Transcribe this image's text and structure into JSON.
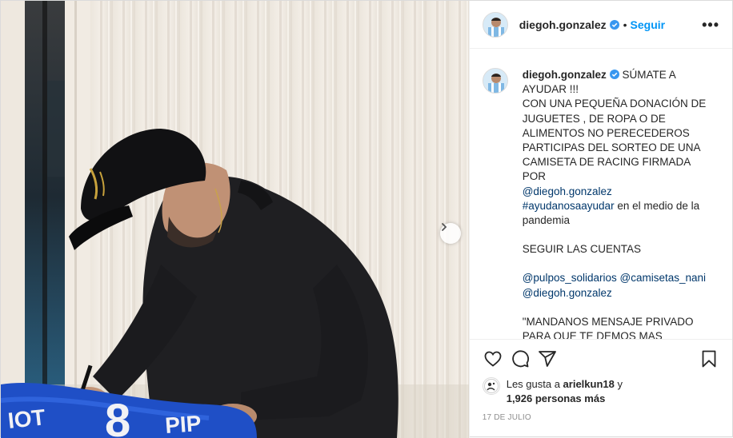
{
  "post": {
    "username": "diegoh.gonzalez",
    "verified": true,
    "follow_label": "Seguir",
    "more_label": "•••",
    "caption": {
      "lines": [
        {
          "type": "text",
          "text": "SÚMATE A AYUDAR !!!"
        },
        {
          "type": "text",
          "text": "CON UNA PEQUEÑA DONACIÓN DE JUGUETES , DE ROPA O DE ALIMENTOS NO PERECEDEROS PARTICIPAS DEL SORTEO DE UNA CAMISETA DE RACING FIRMADA POR"
        },
        {
          "type": "link",
          "text": "@diegoh.gonzalez"
        },
        {
          "type": "mixed",
          "link": "#ayudanosaayudar",
          "text": " en el medio de la pandemia"
        },
        {
          "type": "text",
          "text": "SEGUIR LAS CUENTAS"
        },
        {
          "type": "links",
          "items": [
            "@pulpos_solidarios",
            "@camisetas_nani",
            "@diegoh.gonzalez"
          ]
        },
        {
          "type": "text",
          "text": "\"MANDANOS MENSAJE PRIVADO PARA QUE TE DEMOS MAS DIRECCIONES DONDE PODER DEJAR"
        }
      ]
    },
    "likes": {
      "prefix": "Les gusta a ",
      "user": "arielkun18",
      "mid": " y",
      "count": "1,926 personas más"
    },
    "date": "17 DE JULIO"
  },
  "icons": {
    "like": "heart-icon",
    "comment": "comment-icon",
    "share": "share-icon",
    "save": "bookmark-icon",
    "next": "chevron-right-icon",
    "verified": "verified-badge-icon"
  },
  "colors": {
    "follow": "#0095f6",
    "link": "#00376b",
    "verified": "#3897f0",
    "muted": "#8e8e8e"
  },
  "jersey_text": "PIP"
}
